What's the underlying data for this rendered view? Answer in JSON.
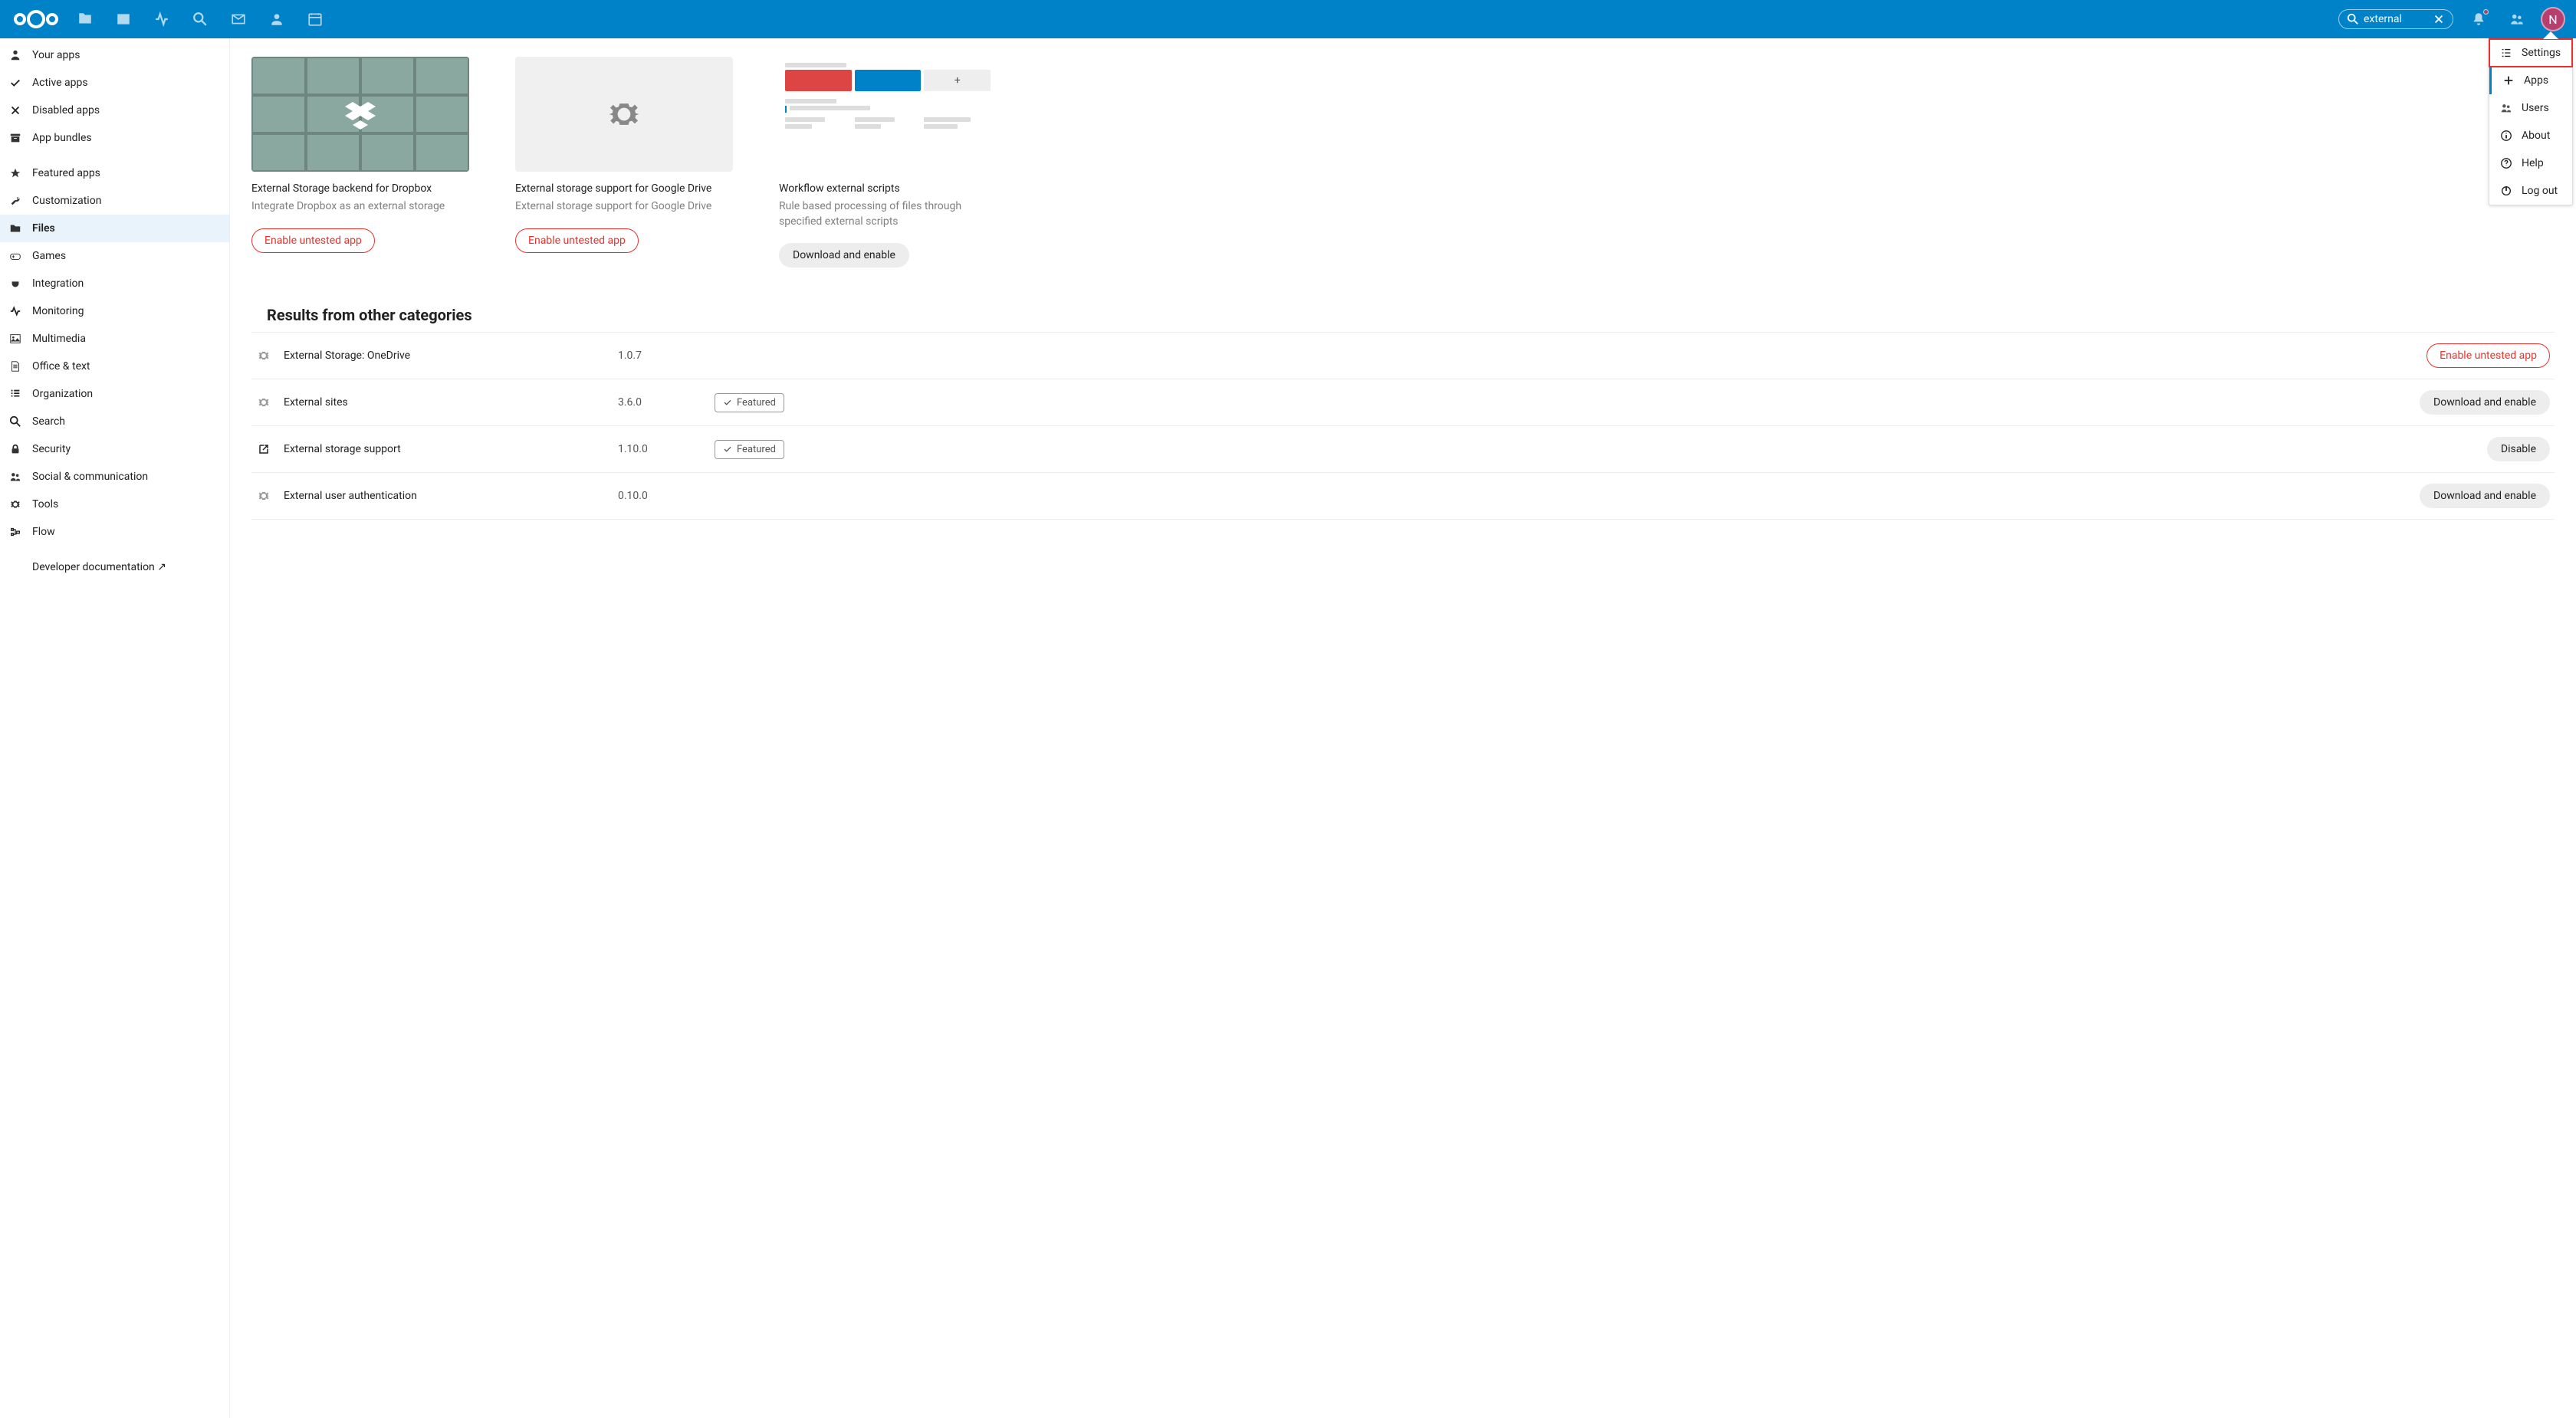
{
  "search": {
    "value": "external"
  },
  "avatar_letter": "N",
  "dropdown": {
    "items": [
      {
        "label": "Settings",
        "icon": "settings-list"
      },
      {
        "label": "Apps",
        "icon": "plus"
      },
      {
        "label": "Users",
        "icon": "users"
      },
      {
        "label": "About",
        "icon": "info"
      },
      {
        "label": "Help",
        "icon": "help"
      },
      {
        "label": "Log out",
        "icon": "power"
      }
    ]
  },
  "sidebar": {
    "items": [
      "Your apps",
      "Active apps",
      "Disabled apps",
      "App bundles",
      "Featured apps",
      "Customization",
      "Files",
      "Games",
      "Integration",
      "Monitoring",
      "Multimedia",
      "Office & text",
      "Organization",
      "Search",
      "Security",
      "Social & communication",
      "Tools",
      "Flow",
      "Developer documentation ↗"
    ]
  },
  "cards": [
    {
      "title": "External Storage backend for Dropbox",
      "desc": "Integrate Dropbox as an external storage",
      "action": "Enable untested app",
      "action_type": "enable"
    },
    {
      "title": "External storage support for Google Drive",
      "desc": "External storage support for Google Drive",
      "action": "Enable untested app",
      "action_type": "enable"
    },
    {
      "title": "Workflow external scripts",
      "desc": "Rule based processing of files through specified external scripts",
      "action": "Download and enable",
      "action_type": "gray"
    }
  ],
  "section_heading": "Results from other categories",
  "featured_label": "Featured",
  "rows": [
    {
      "name": "External Storage: OneDrive",
      "version": "1.0.7",
      "featured": false,
      "action": "Enable untested app",
      "action_type": "enable",
      "icon": "gear"
    },
    {
      "name": "External sites",
      "version": "3.6.0",
      "featured": true,
      "action": "Download and enable",
      "action_type": "gray",
      "icon": "gear"
    },
    {
      "name": "External storage support",
      "version": "1.10.0",
      "featured": true,
      "action": "Disable",
      "action_type": "gray",
      "icon": "external"
    },
    {
      "name": "External user authentication",
      "version": "0.10.0",
      "featured": false,
      "action": "Download and enable",
      "action_type": "gray",
      "icon": "gear"
    }
  ]
}
